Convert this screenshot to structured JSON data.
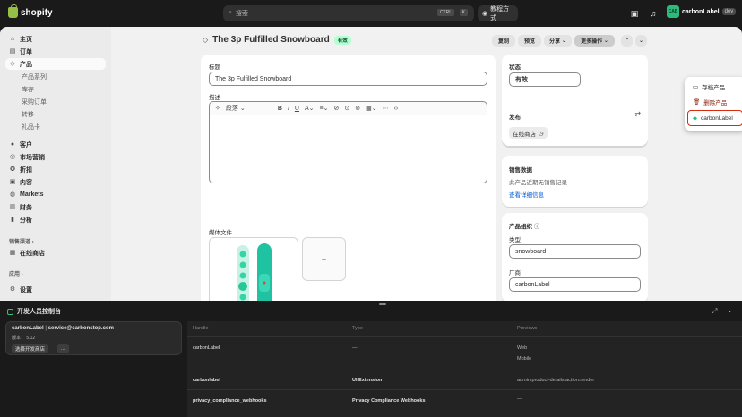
{
  "topbar": {
    "brand": "shopify",
    "search_placeholder": "搜索",
    "shortcut_1": "CTRL",
    "shortcut_2": "K",
    "tutorial_label": "教程方式",
    "store_initials": "CAB",
    "store_name": "carbonLabel",
    "store_badge": "dev"
  },
  "sidebar": {
    "items": [
      {
        "label": "主页",
        "icon": "home-icon"
      },
      {
        "label": "订单",
        "icon": "orders-icon"
      },
      {
        "label": "产品",
        "icon": "tag-icon"
      },
      {
        "label": "产品系列"
      },
      {
        "label": "库存"
      },
      {
        "label": "采购订单"
      },
      {
        "label": "转移"
      },
      {
        "label": "礼品卡"
      },
      {
        "label": "客户",
        "icon": "customer-icon"
      },
      {
        "label": "市场营销",
        "icon": "marketing-icon"
      },
      {
        "label": "折扣",
        "icon": "discount-icon"
      },
      {
        "label": "内容",
        "icon": "content-icon"
      },
      {
        "label": "Markets",
        "icon": "globe-icon"
      },
      {
        "label": "财务",
        "icon": "finance-icon"
      },
      {
        "label": "分析",
        "icon": "analytics-icon"
      },
      {
        "label": "在线商店",
        "icon": "store-icon"
      },
      {
        "label": "设置",
        "icon": "gear-icon"
      }
    ],
    "section_channels": "销售渠道",
    "section_apps": "应用"
  },
  "product": {
    "title": "The 3p Fulfilled Snowboard",
    "status_badge": "有效",
    "actions": {
      "copy": "复制",
      "preview": "预览",
      "share": "分享",
      "more": "更多操作"
    },
    "title_label": "标题",
    "title_value": "The 3p Fulfilled Snowboard",
    "description_label": "描述",
    "paragraph_option": "段落",
    "media_label": "媒体文件"
  },
  "menu": {
    "items": [
      "存档产品",
      "删除产品",
      "carbonLabel"
    ]
  },
  "status_card": {
    "label": "状态",
    "value": "有效"
  },
  "publish_card": {
    "label": "发布",
    "channel": "在线商店"
  },
  "insights_card": {
    "label": "销售数据",
    "text": "此产品近期无销售记录",
    "link": "查看详细信息"
  },
  "org_card": {
    "label": "产品组织",
    "type_label": "类型",
    "type_value": "snowboard",
    "vendor_label": "厂商",
    "vendor_value": "carbonLabel"
  },
  "devpanel": {
    "title": "开发人员控制台",
    "app_name": "carbonLabel",
    "app_email": "service@carbonstop.com",
    "version_label": "版本：",
    "version_value": "5.12",
    "select_button": "选择开发商店",
    "more_button": "...",
    "columns": [
      "Handle",
      "Type",
      "Previews"
    ],
    "rows": [
      {
        "handle": "carbonLabel",
        "type": "—",
        "previews": [
          "Web",
          "Mobile"
        ]
      },
      {
        "handle": "carbonlabel",
        "type": "UI Extension",
        "previews": [
          "admin.product-details.action.render"
        ]
      },
      {
        "handle": "privacy_compliance_webhooks",
        "type": "Privacy Compliance Webhooks",
        "previews": [
          "—"
        ]
      }
    ]
  }
}
